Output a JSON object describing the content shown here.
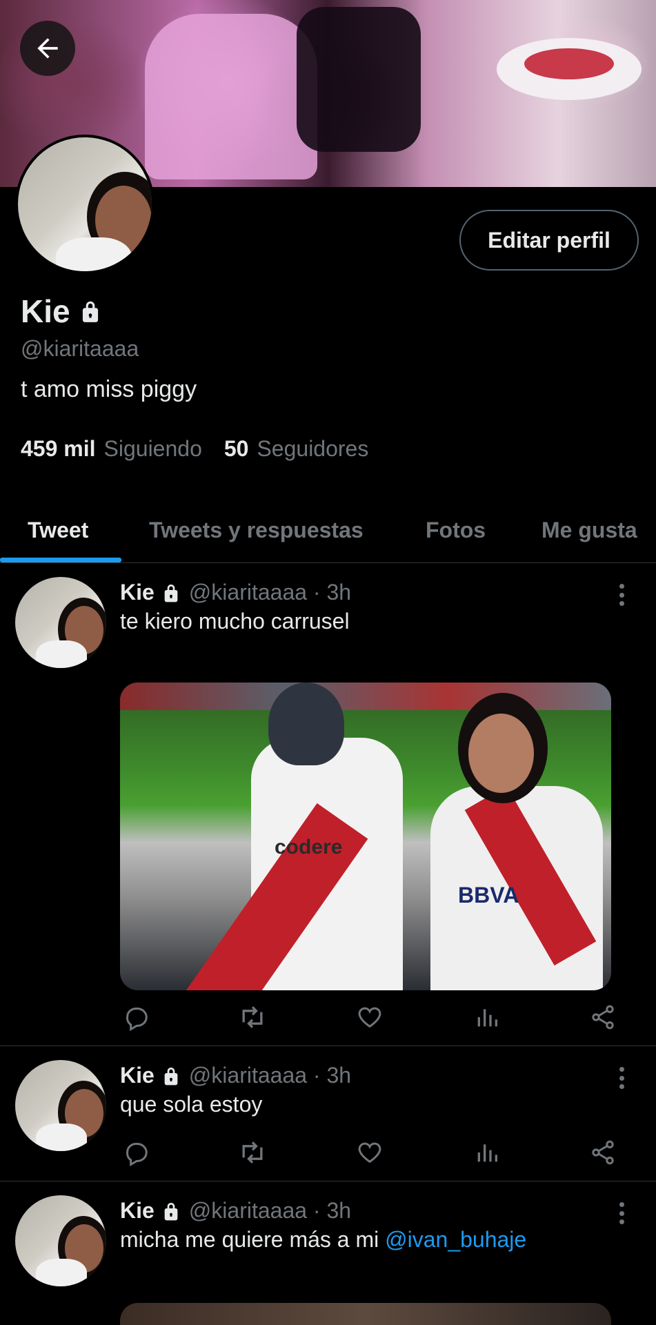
{
  "profile": {
    "display_name": "Kie",
    "handle": "@kiaritaaaa",
    "bio": "t amo miss piggy",
    "following_count": "459 mil",
    "following_label": "Siguiendo",
    "followers_count": "50",
    "followers_label": "Seguidores",
    "edit_button": "Editar perfil",
    "locked": true
  },
  "tabs": [
    {
      "label": "Tweet",
      "active": true
    },
    {
      "label": "Tweets y respuestas",
      "active": false
    },
    {
      "label": "Fotos",
      "active": false
    },
    {
      "label": "Me gusta",
      "active": false
    }
  ],
  "tweets": [
    {
      "name": "Kie",
      "meta": "@kiaritaaaa · 3h",
      "text": "te kiero mucho carrusel",
      "has_media": true,
      "media_text_1": "codere",
      "media_text_2": "BBVA"
    },
    {
      "name": "Kie",
      "meta": "@kiaritaaaa · 3h",
      "text": "que sola estoy",
      "has_media": false
    },
    {
      "name": "Kie",
      "meta": "@kiaritaaaa · 3h",
      "text_prefix": "micha me quiere más a mi ",
      "mention": "@ivan_buhaje",
      "has_media": true
    }
  ],
  "icons": {
    "back": "arrow-left-icon",
    "lock": "lock-icon",
    "more": "more-vertical-icon",
    "reply": "reply-icon",
    "retweet": "retweet-icon",
    "like": "heart-icon",
    "views": "analytics-icon",
    "share": "share-icon"
  },
  "colors": {
    "background": "#000000",
    "text_primary": "#e7e9ea",
    "text_secondary": "#71767b",
    "accent": "#1d9bf0",
    "divider": "#2f3336"
  }
}
